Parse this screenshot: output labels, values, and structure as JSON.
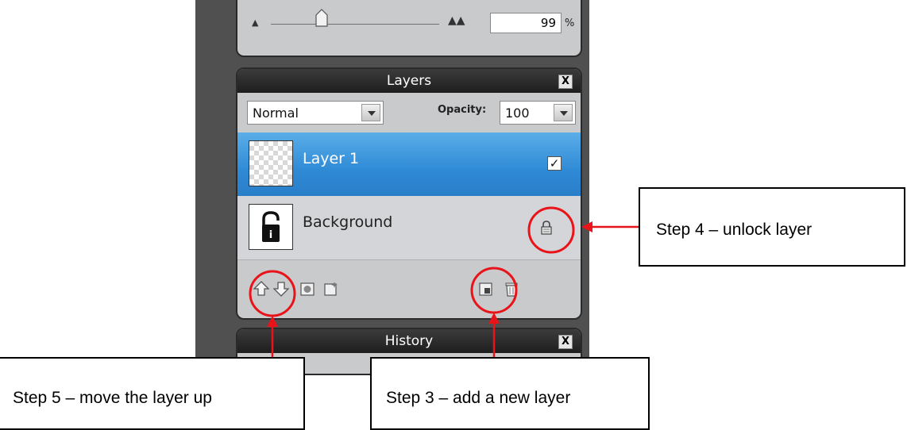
{
  "navigator": {
    "zoom_value": "99",
    "zoom_unit": "%"
  },
  "layers_panel": {
    "title": "Layers",
    "close_label": "X",
    "blend_mode": "Normal",
    "opacity_label": "Opacity:",
    "opacity_value": "100",
    "layers": [
      {
        "name": "Layer 1",
        "selected": true,
        "visible_check": "✓"
      },
      {
        "name": "Background",
        "selected": false,
        "locked": true
      }
    ],
    "toolbar_icons": [
      "move-layer-up-icon",
      "move-layer-down-icon",
      "layer-mask-icon",
      "layer-style-icon",
      "new-layer-icon",
      "delete-layer-icon"
    ]
  },
  "history_panel": {
    "title": "History",
    "close_label": "X"
  },
  "callouts": {
    "step4": "Step 4 – unlock layer",
    "step5": "Step 5 – move the layer up",
    "step3": "Step 3 – add a new layer"
  },
  "colors": {
    "annotation_red": "#e8141a",
    "selection_blue": "#2f8ad6",
    "panel_header": "#1e1e1e",
    "app_background": "#505050"
  }
}
